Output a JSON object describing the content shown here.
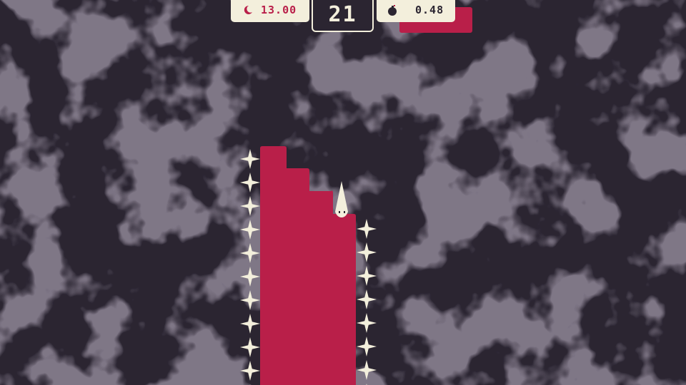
{
  "hud": {
    "timer": {
      "icon": "moon-icon",
      "value": "13.00"
    },
    "score": {
      "value": "21"
    },
    "bomb": {
      "icon": "bomb-icon",
      "value": "0.48"
    }
  },
  "colors": {
    "background": "#2b2531",
    "background_blotch": "#362f3d",
    "platform": "#b91f49",
    "spike": "#f3efdc",
    "hud_panel": "#f3efdc",
    "hud_text": "#2b2531",
    "timer_text": "#b91f49"
  },
  "game": {
    "player": {
      "description": "white-cone-character",
      "state": "standing"
    },
    "hazards": "spike-stars"
  }
}
